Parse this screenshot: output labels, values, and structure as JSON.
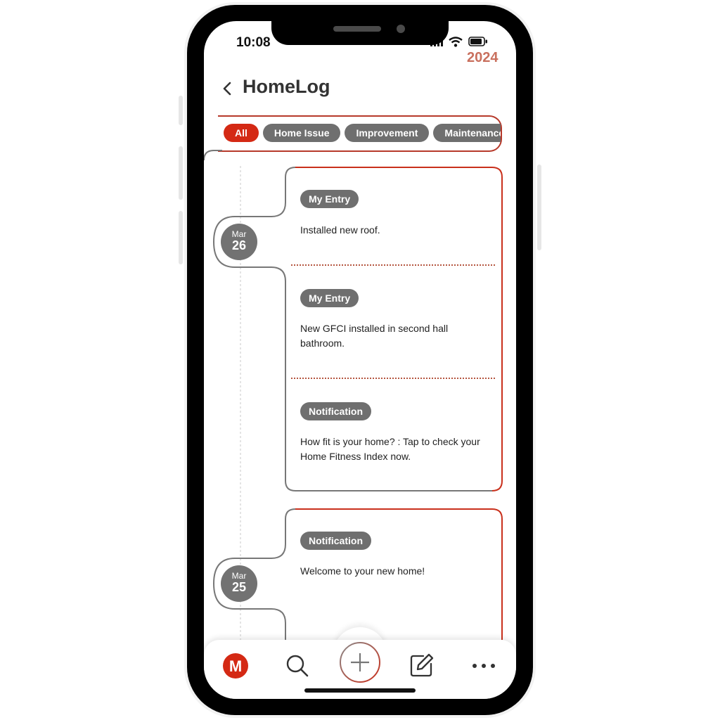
{
  "status_bar": {
    "time": "10:08"
  },
  "header": {
    "year": "2024",
    "title": "HomeLog"
  },
  "filters": [
    {
      "label": "All",
      "active": true
    },
    {
      "label": "Home Issue",
      "active": false
    },
    {
      "label": "Improvement",
      "active": false
    },
    {
      "label": "Maintenance",
      "active": false
    }
  ],
  "timeline": [
    {
      "month": "Mar",
      "day": "26",
      "entries": [
        {
          "tag": "My Entry",
          "text": "Installed new roof."
        },
        {
          "tag": "My Entry",
          "text": "New GFCI installed in second hall bathroom."
        },
        {
          "tag": "Notification",
          "text": "How fit is your home? : Tap to check your Home Fitness Index now."
        }
      ]
    },
    {
      "month": "Mar",
      "day": "25",
      "entries": [
        {
          "tag": "Notification",
          "text": "Welcome to your new home!"
        }
      ]
    }
  ],
  "bottom_nav": {
    "logo_letter": "M",
    "icons": [
      "logo-icon",
      "search-icon",
      "plus-icon",
      "edit-icon",
      "more-icon"
    ]
  },
  "colors": {
    "accent": "#d42914",
    "chip_gray": "#6f6f6f",
    "year": "#c9705e"
  }
}
